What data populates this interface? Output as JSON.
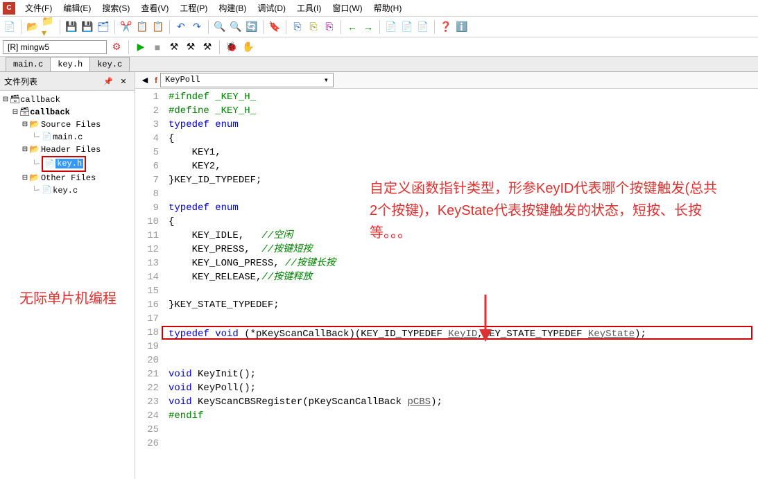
{
  "menu": {
    "file": "文件(F)",
    "edit": "编辑(E)",
    "search": "搜索(S)",
    "view": "查看(V)",
    "project": "工程(P)",
    "build": "构建(B)",
    "debug": "调试(D)",
    "tools": "工具(I)",
    "window": "窗口(W)",
    "help": "帮助(H)"
  },
  "config": "[R] mingw5",
  "tabs": [
    "main.c",
    "key.h",
    "key.c"
  ],
  "active_tab": "key.h",
  "sidebar": {
    "title": "文件列表",
    "tree": {
      "root": "callback",
      "project": "callback",
      "source_folder": "Source Files",
      "source_files": [
        "main.c"
      ],
      "header_folder": "Header Files",
      "header_files": [
        "key.h"
      ],
      "other_folder": "Other Files",
      "other_files": [
        "key.c"
      ]
    }
  },
  "symbol": "KeyPoll",
  "code": {
    "l1": "#ifndef _KEY_H_",
    "l2": "#define _KEY_H_",
    "l3a": "typedef",
    "l3b": "enum",
    "l4": "{",
    "l5": "    KEY1,",
    "l6": "    KEY2,",
    "l7": "}KEY_ID_TYPEDEF;",
    "l9a": "typedef",
    "l9b": "enum",
    "l10": "{",
    "l11a": "    KEY_IDLE,   ",
    "l11b": "//空闲",
    "l12a": "    KEY_PRESS,  ",
    "l12b": "//按键短按",
    "l13a": "    KEY_LONG_PRESS, ",
    "l13b": "//按键长按",
    "l14a": "    KEY_RELEASE,",
    "l14b": "//按键释放",
    "l16": "}KEY_STATE_TYPEDEF;",
    "l18a": "typedef",
    "l18b": "void",
    "l18c": " (*pKeyScanCallBack)(KEY_ID_TYPEDEF ",
    "l18d": "KeyID",
    "l18e": ",KEY_STATE_TYPEDEF ",
    "l18f": "KeyState",
    "l18g": ");",
    "l21a": "void",
    "l21b": " KeyInit();",
    "l22a": "void",
    "l22b": " KeyPoll();",
    "l23a": "void",
    "l23b": " KeyScanCBSRegister(pKeyScanCallBack ",
    "l23c": "pCBS",
    "l23d": ");",
    "l24": "#endif"
  },
  "annotation_left": "无际单片机编程",
  "annotation_right": "自定义函数指针类型，形参KeyID代表哪个按键触发(总共2个按键)，KeyState代表按键触发的状态，短按、长按等。。。"
}
